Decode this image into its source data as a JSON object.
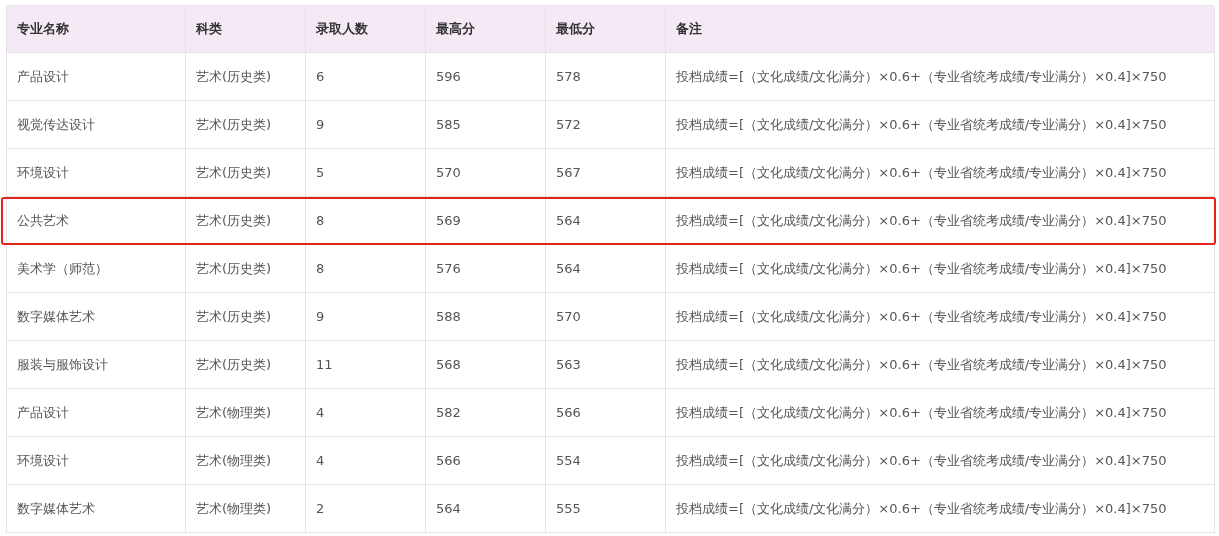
{
  "table": {
    "columns": [
      "专业名称",
      "科类",
      "录取人数",
      "最高分",
      "最低分",
      "备注"
    ],
    "rows": [
      {
        "cells": [
          "产品设计",
          "艺术(历史类)",
          "6",
          "596",
          "578",
          "投档成绩=[（文化成绩/文化满分）×0.6+（专业省统考成绩/专业满分）×0.4]×750"
        ],
        "highlighted": false
      },
      {
        "cells": [
          "视觉传达设计",
          "艺术(历史类)",
          "9",
          "585",
          "572",
          "投档成绩=[（文化成绩/文化满分）×0.6+（专业省统考成绩/专业满分）×0.4]×750"
        ],
        "highlighted": false
      },
      {
        "cells": [
          "环境设计",
          "艺术(历史类)",
          "5",
          "570",
          "567",
          "投档成绩=[（文化成绩/文化满分）×0.6+（专业省统考成绩/专业满分）×0.4]×750"
        ],
        "highlighted": false
      },
      {
        "cells": [
          "公共艺术",
          "艺术(历史类)",
          "8",
          "569",
          "564",
          "投档成绩=[（文化成绩/文化满分）×0.6+（专业省统考成绩/专业满分）×0.4]×750"
        ],
        "highlighted": true
      },
      {
        "cells": [
          "美术学（师范）",
          "艺术(历史类)",
          "8",
          "576",
          "564",
          "投档成绩=[（文化成绩/文化满分）×0.6+（专业省统考成绩/专业满分）×0.4]×750"
        ],
        "highlighted": false
      },
      {
        "cells": [
          "数字媒体艺术",
          "艺术(历史类)",
          "9",
          "588",
          "570",
          "投档成绩=[（文化成绩/文化满分）×0.6+（专业省统考成绩/专业满分）×0.4]×750"
        ],
        "highlighted": false
      },
      {
        "cells": [
          "服装与服饰设计",
          "艺术(历史类)",
          "11",
          "568",
          "563",
          "投档成绩=[（文化成绩/文化满分）×0.6+（专业省统考成绩/专业满分）×0.4]×750"
        ],
        "highlighted": false
      },
      {
        "cells": [
          "产品设计",
          "艺术(物理类)",
          "4",
          "582",
          "566",
          "投档成绩=[（文化成绩/文化满分）×0.6+（专业省统考成绩/专业满分）×0.4]×750"
        ],
        "highlighted": false
      },
      {
        "cells": [
          "环境设计",
          "艺术(物理类)",
          "4",
          "566",
          "554",
          "投档成绩=[（文化成绩/文化满分）×0.6+（专业省统考成绩/专业满分）×0.4]×750"
        ],
        "highlighted": false
      },
      {
        "cells": [
          "数字媒体艺术",
          "艺术(物理类)",
          "2",
          "564",
          "555",
          "投档成绩=[（文化成绩/文化满分）×0.6+（专业省统考成绩/专业满分）×0.4]×750"
        ],
        "highlighted": false
      }
    ]
  }
}
